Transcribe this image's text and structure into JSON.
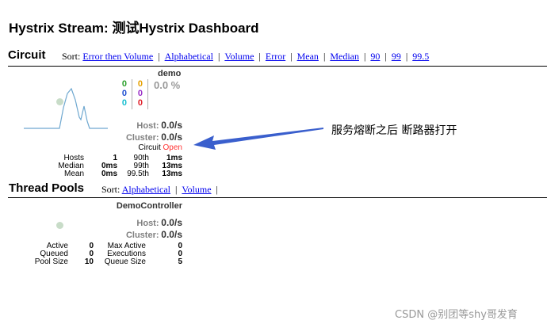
{
  "page": {
    "title": "Hystrix Stream: 测试Hystrix Dashboard"
  },
  "circuit_section": {
    "title": "Circuit",
    "sort_label": "Sort:",
    "sort_options": [
      "Error then Volume",
      "Alphabetical",
      "Volume",
      "Error",
      "Mean",
      "Median",
      "90",
      "99",
      "99.5"
    ],
    "command": {
      "name": "demo",
      "counts_left": [
        "0",
        "0",
        "0"
      ],
      "counts_left_colors": [
        "#2ca02c",
        "#1f4fd1",
        "#17becf"
      ],
      "counts_right": [
        "0",
        "0",
        "0"
      ],
      "counts_right_colors": [
        "#e6a000",
        "#9b30c8",
        "#e0202a"
      ],
      "error_rate": "0.0 %",
      "host_label": "Host:",
      "host_rate": "0.0/s",
      "cluster_label": "Cluster:",
      "cluster_rate": "0.0/s",
      "circuit_label": "Circuit",
      "circuit_status": "Open",
      "circuit_status_color": "#ff3333",
      "sparkline_color": "#6fa8d0",
      "stats": [
        [
          "Hosts",
          "1",
          "90th",
          "1ms"
        ],
        [
          "Median",
          "0ms",
          "99th",
          "13ms"
        ],
        [
          "Mean",
          "0ms",
          "99.5th",
          "13ms"
        ]
      ]
    }
  },
  "threadpool_section": {
    "title": "Thread Pools",
    "sort_label": "Sort:",
    "sort_options": [
      "Alphabetical",
      "Volume"
    ],
    "pool": {
      "name": "DemoController",
      "host_label": "Host:",
      "host_rate": "0.0/s",
      "cluster_label": "Cluster:",
      "cluster_rate": "0.0/s",
      "stats": [
        [
          "Active",
          "0",
          "Max Active",
          "0"
        ],
        [
          "Queued",
          "0",
          "Executions",
          "0"
        ],
        [
          "Pool Size",
          "10",
          "Queue Size",
          "5"
        ]
      ]
    }
  },
  "annotation": {
    "text": "服务熔断之后  断路器打开",
    "arrow_color": "#3a5fcd"
  },
  "watermark": {
    "text": "CSDN @别团等shy哥发育"
  }
}
